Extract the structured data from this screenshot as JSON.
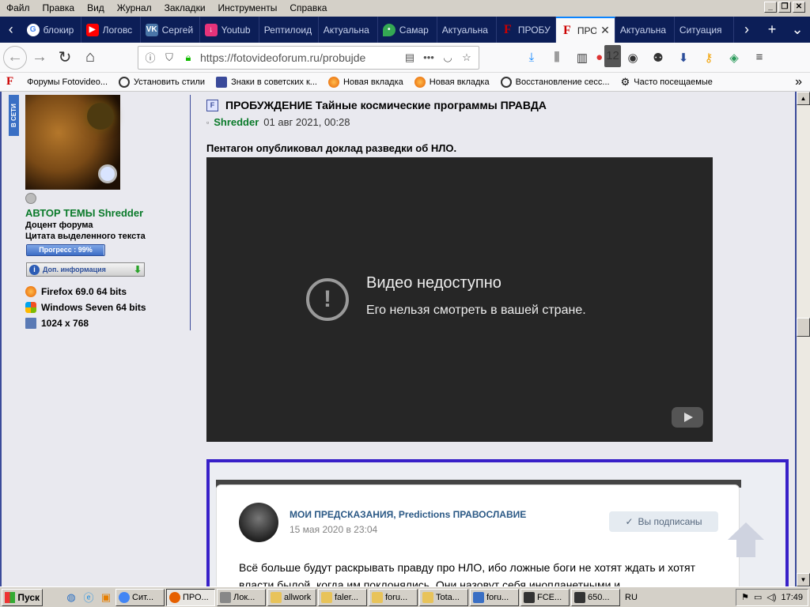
{
  "menu": [
    "Файл",
    "Правка",
    "Вид",
    "Журнал",
    "Закладки",
    "Инструменты",
    "Справка"
  ],
  "window_controls": [
    "_",
    "❐",
    "✕"
  ],
  "tabs": [
    {
      "label": "блокир",
      "icon": "google-icon",
      "color": "#ffffff"
    },
    {
      "label": "Логовс",
      "icon": "youtube-icon",
      "color": "#ff0000"
    },
    {
      "label": "Сергей",
      "icon": "vk-icon",
      "color": "#4a76a8"
    },
    {
      "label": "Youtub",
      "icon": "download-icon",
      "color": "#e6337a"
    },
    {
      "label": "Рептилоид",
      "icon": "none",
      "color": "#0c1e57"
    },
    {
      "label": "Актуальна",
      "icon": "none",
      "color": "#0c1e57"
    },
    {
      "label": "Самар",
      "icon": "maps-icon",
      "color": "#34a853"
    },
    {
      "label": "Актуальна",
      "icon": "none",
      "color": "#0c1e57"
    },
    {
      "label": "ПРОБУ",
      "icon": "forum-f-icon",
      "color": "#cc0000"
    },
    {
      "label": "ПРО",
      "icon": "forum-f-icon",
      "color": "#cc0000",
      "active": true
    },
    {
      "label": "Актуальна",
      "icon": "none",
      "color": "#0c1e57"
    },
    {
      "label": "Ситуация",
      "icon": "none",
      "color": "#0c1e57"
    }
  ],
  "nav": {
    "url": "https://fotovideoforum.ru/probujde",
    "badge": "12"
  },
  "bookmarks": [
    {
      "label": "Форумы Fotovideo...",
      "color": "#cc0000"
    },
    {
      "label": "Установить стили",
      "color": "#333333"
    },
    {
      "label": "Знаки в советских к...",
      "color": "#3a4a9a"
    },
    {
      "label": "Новая вкладка",
      "color": "#e66000"
    },
    {
      "label": "Новая вкладка",
      "color": "#e66000"
    },
    {
      "label": "Восстановление сесс...",
      "color": "#333333"
    },
    {
      "label": "Часто посещаемые",
      "color": "#333333"
    }
  ],
  "sidebar": {
    "online_label": "В СЕТИ",
    "author": "АВТОР ТЕМЫ Shredder",
    "rank": "Доцент форума",
    "quote_label": "Цитата выделенного текста",
    "progress_label": "Прогресс : 99%",
    "progress_value": 0.99,
    "more_info": "Доп. информация",
    "browser": "Firefox 69.0 64 bits",
    "os": "Windows Seven 64 bits",
    "resolution": "1024 x 768"
  },
  "post": {
    "icon_letter": "F",
    "title": "ПРОБУЖДЕНИЕ Тайные космические программы ПРАВДА",
    "author": "Shredder",
    "date": "01 авг 2021, 00:28",
    "lead": "Пентагон опубликовал доклад разведки об НЛО."
  },
  "video": {
    "error_title": "Видео недоступно",
    "error_text": "Его нельзя смотреть в вашей стране."
  },
  "embed": {
    "channel": "МОИ ПРЕДСКАЗАНИЯ, Predictions ПРАВОСЛАВИЕ",
    "date": "15 мая 2020 в 23:04",
    "subscribed": "Вы подписаны",
    "text": "Всё больше будут раскрывать правду про НЛО, ибо ложные боги не хотят ждать и хотят власти былой, когда им поклонялись. Они назовут себя инопланетными и"
  },
  "taskbar": {
    "start": "Пуск",
    "items": [
      {
        "label": "Сит...",
        "color": "#4285f4"
      },
      {
        "label": "ПРО...",
        "color": "#e66000",
        "active": true
      },
      {
        "label": "Лок...",
        "color": "#888888"
      },
      {
        "label": "allwork",
        "color": "#e8c35a"
      },
      {
        "label": "faler...",
        "color": "#e8c35a"
      },
      {
        "label": "foru...",
        "color": "#e8c35a"
      },
      {
        "label": "Tota...",
        "color": "#e8c35a"
      },
      {
        "label": "foru...",
        "color": "#3a6fc4"
      },
      {
        "label": "FCE...",
        "color": "#333333"
      },
      {
        "label": "650...",
        "color": "#333333"
      }
    ],
    "lang": "RU",
    "time": "17:49"
  }
}
